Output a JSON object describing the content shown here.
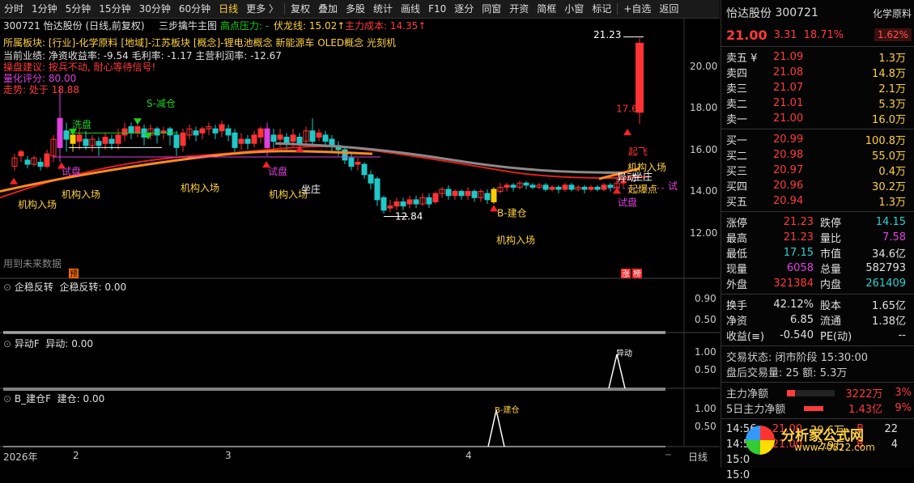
{
  "toolbar": {
    "items": [
      "分时",
      "1分钟",
      "5分钟",
      "15分钟",
      "30分钟",
      "60分钟",
      "日线",
      "更多 〉",
      "复权",
      "叠加",
      "多股",
      "统计",
      "画线",
      "F10",
      "逐分",
      "同窗",
      "开资",
      "简框",
      "小窗",
      "标记",
      "+自选",
      "返回"
    ],
    "active_index": 6
  },
  "chart": {
    "title_line": "300721 怡达股份 (日线,前复权)",
    "formula": "三步擒牛主图",
    "pressure": "高点压力: -",
    "fulong": "伏龙线: 15.02↑",
    "cost": "主力成本: 14.35↑",
    "sector": "所属板块: [行业]-化学原料 [地域]-江苏板块 [概念]-锂电池概念 新能源车 OLED概念 光刻机",
    "perf": "当前业绩: 净资收益率: -9.54 毛利率: -1.17 主营利润率: -12.67",
    "advice": "操盘建议: 按兵不动, 耐心等待信号!",
    "score": "量化评分: 80.00",
    "trend": "走势: 处于",
    "trend_val": "18.88",
    "future_note": "用到未来数据",
    "y_ticks": [
      "20.00",
      "18.00",
      "16.00",
      "14.00",
      "12.00"
    ],
    "high_label": "21.23",
    "low_label": "12.84",
    "price_1769": "17.69",
    "labels": {
      "wash": "洗盘",
      "reduce": "S-减仓",
      "trial1": "试盘",
      "trial2": "试盘",
      "trial3": "试盘",
      "inst1": "机构入场",
      "inst2": "机构入场",
      "inst3": "机构入场",
      "inst4": "机构入场",
      "inst5": "机构入场",
      "inst6": "机构入场",
      "sit": "坐庄",
      "build": "B-建仓",
      "takeoff": "起飞",
      "abnormal": "异动",
      "sit2": "坐庄",
      "start": "起爆点",
      "pre": "预",
      "zhang": "涨",
      "bang": "榜",
      "edge_trial": "试"
    },
    "panels": [
      {
        "name": "企稳反转",
        "value": "企稳反转: 0.00",
        "ticks": [
          "0.90",
          "0.50"
        ]
      },
      {
        "name": "异动F",
        "value": "异动: 0.00",
        "ticks": [
          "1.00",
          "0.50"
        ],
        "tag": "异动"
      },
      {
        "name": "B_建仓F",
        "value": "建仓: 0.00",
        "ticks": [
          "1.00",
          "0.50"
        ],
        "tag": "B-建仓"
      }
    ],
    "x_axis": {
      "year": "2026年",
      "marks": [
        "2",
        "3",
        "4"
      ],
      "right": "日线"
    }
  },
  "quote": {
    "name": "怡达股份",
    "code": "300721",
    "industry_tag": "化学原料",
    "price": "21.00",
    "change": "3.31",
    "pct": "18.71%",
    "right_pct": "1.62%",
    "asks": [
      {
        "label": "卖五 ¥",
        "price": "21.09",
        "vol": "1.3万"
      },
      {
        "label": "卖四",
        "price": "21.08",
        "vol": "14.8万"
      },
      {
        "label": "卖三",
        "price": "21.07",
        "vol": "2.1万"
      },
      {
        "label": "卖二",
        "price": "21.01",
        "vol": "5.3万"
      },
      {
        "label": "卖一",
        "price": "21.00",
        "vol": "16.0万"
      }
    ],
    "bids": [
      {
        "label": "买一",
        "price": "20.99",
        "vol": "100.8万"
      },
      {
        "label": "买二",
        "price": "20.98",
        "vol": "55.0万"
      },
      {
        "label": "买三",
        "price": "20.97",
        "vol": "0.4万"
      },
      {
        "label": "买四",
        "price": "20.96",
        "vol": "30.2万"
      },
      {
        "label": "买五",
        "price": "20.94",
        "vol": "1.3万"
      }
    ],
    "stats": [
      {
        "k1": "涨停",
        "v1": "21.23",
        "c1": "red",
        "k2": "跌停",
        "v2": "14.15",
        "c2": "cyan"
      },
      {
        "k1": "最高",
        "v1": "21.23",
        "c1": "red",
        "k2": "量比",
        "v2": "7.58",
        "c2": "mag"
      },
      {
        "k1": "最低",
        "v1": "17.15",
        "c1": "cyan",
        "k2": "市值",
        "v2": "34.6亿",
        "c2": "white"
      },
      {
        "k1": "现量",
        "v1": "6058",
        "c1": "mag",
        "k2": "总量",
        "v2": "582793",
        "c2": "white"
      },
      {
        "k1": "外盘",
        "v1": "321384",
        "c1": "red",
        "k2": "内盘",
        "v2": "261409",
        "c2": "cyan"
      }
    ],
    "fin": [
      {
        "k1": "换手",
        "v1": "42.12%",
        "k2": "股本",
        "v2": "1.65亿"
      },
      {
        "k1": "净资",
        "v1": "6.85",
        "k2": "流通",
        "v2": "1.38亿"
      },
      {
        "k1": "收益(≡)",
        "v1": "-0.540",
        "k2": "PE(动)",
        "v2": "--"
      }
    ],
    "trade_status": "交易状态: 闭市阶段 15:30:00",
    "after_hours": "盘后交易量: 25  额: 5.3万",
    "main_flow": {
      "label": "主力净额",
      "value": "3222万",
      "pct": "3%"
    },
    "five_day_flow": {
      "label": "5日主力净额",
      "value": "1.43亿",
      "pct": "9%"
    },
    "ticks": [
      {
        "time": "14:56",
        "price": "21.00",
        "vol": "29.6万",
        "side": "B",
        "n": "22"
      },
      {
        "time": "14:57",
        "price": "21.00",
        "vol": "2.9万",
        "side": "B",
        "n": "4"
      },
      {
        "time": "15:0",
        "price": "",
        "vol": "",
        "side": "",
        "n": ""
      },
      {
        "time": "15:0",
        "price": "",
        "vol": "",
        "side": "",
        "n": ""
      }
    ],
    "watermark": "分析家公式网",
    "watermark_url": "www.70822.com"
  }
}
